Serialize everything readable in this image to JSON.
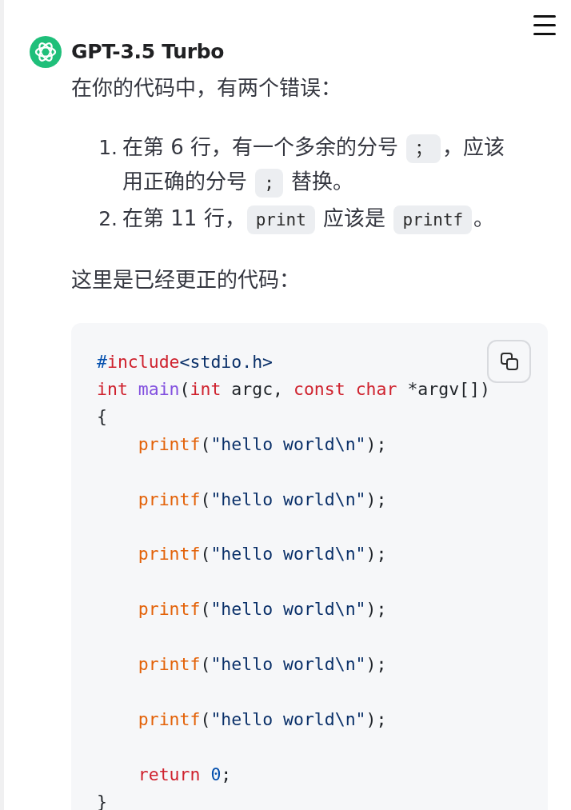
{
  "title": "GPT-3.5 Turbo",
  "message": {
    "intro": "在你的代码中，有两个错误：",
    "errors": [
      {
        "marker": "1.",
        "parts": [
          {
            "kind": "text",
            "text": "在第 6 行，有一个多余的分号 "
          },
          {
            "kind": "code",
            "text": "；"
          },
          {
            "kind": "text",
            "text": "，应该用正确的分号 "
          },
          {
            "kind": "code",
            "text": ";"
          },
          {
            "kind": "text",
            "text": " 替换。"
          }
        ]
      },
      {
        "marker": "2.",
        "parts": [
          {
            "kind": "text",
            "text": "在第 11 行，"
          },
          {
            "kind": "code",
            "text": "print"
          },
          {
            "kind": "text",
            "text": " 应该是 "
          },
          {
            "kind": "code",
            "text": "printf"
          },
          {
            "kind": "text",
            "text": "。"
          }
        ]
      }
    ],
    "outro": "这里是已经更正的代码：",
    "code_block": {
      "lines": [
        {
          "kind": "code",
          "tokens": [
            {
              "kind": "constant",
              "text": "#"
            },
            {
              "kind": "keyword",
              "text": "include"
            },
            {
              "kind": "string",
              "text": "<stdio.h>"
            }
          ]
        },
        {
          "kind": "code",
          "tokens": [
            {
              "kind": "keyword",
              "text": "int"
            },
            {
              "kind": "entity",
              "text": " main"
            },
            {
              "kind": "plain",
              "text": "("
            },
            {
              "kind": "keyword",
              "text": "int"
            },
            {
              "kind": "plain",
              "text": " argc, "
            },
            {
              "kind": "keyword",
              "text": "const"
            },
            {
              "kind": "keyword",
              "text": " char"
            },
            {
              "kind": "plain",
              "text": " *argv[])"
            }
          ]
        },
        {
          "kind": "code",
          "tokens": [
            {
              "kind": "plain",
              "text": "{"
            }
          ]
        },
        {
          "kind": "code",
          "tokens": [
            {
              "kind": "function",
              "text": "    printf"
            },
            {
              "kind": "plain",
              "text": "("
            },
            {
              "kind": "string",
              "text": "\"hello world\\n\""
            },
            {
              "kind": "plain",
              "text": ");"
            }
          ]
        },
        {
          "kind": "blank"
        },
        {
          "kind": "code",
          "tokens": [
            {
              "kind": "function",
              "text": "    printf"
            },
            {
              "kind": "plain",
              "text": "("
            },
            {
              "kind": "string",
              "text": "\"hello world\\n\""
            },
            {
              "kind": "plain",
              "text": ");"
            }
          ]
        },
        {
          "kind": "blank"
        },
        {
          "kind": "code",
          "tokens": [
            {
              "kind": "function",
              "text": "    printf"
            },
            {
              "kind": "plain",
              "text": "("
            },
            {
              "kind": "string",
              "text": "\"hello world\\n\""
            },
            {
              "kind": "plain",
              "text": ");"
            }
          ]
        },
        {
          "kind": "blank"
        },
        {
          "kind": "code",
          "tokens": [
            {
              "kind": "function",
              "text": "    printf"
            },
            {
              "kind": "plain",
              "text": "("
            },
            {
              "kind": "string",
              "text": "\"hello world\\n\""
            },
            {
              "kind": "plain",
              "text": ");"
            }
          ]
        },
        {
          "kind": "blank"
        },
        {
          "kind": "code",
          "tokens": [
            {
              "kind": "function",
              "text": "    printf"
            },
            {
              "kind": "plain",
              "text": "("
            },
            {
              "kind": "string",
              "text": "\"hello world\\n\""
            },
            {
              "kind": "plain",
              "text": ");"
            }
          ]
        },
        {
          "kind": "blank"
        },
        {
          "kind": "code",
          "tokens": [
            {
              "kind": "function",
              "text": "    printf"
            },
            {
              "kind": "plain",
              "text": "("
            },
            {
              "kind": "string",
              "text": "\"hello world\\n\""
            },
            {
              "kind": "plain",
              "text": ");"
            }
          ]
        },
        {
          "kind": "blank"
        },
        {
          "kind": "code",
          "tokens": [
            {
              "kind": "keyword",
              "text": "    return"
            },
            {
              "kind": "constant",
              "text": " 0"
            },
            {
              "kind": "plain",
              "text": ";"
            }
          ]
        },
        {
          "kind": "code",
          "tokens": [
            {
              "kind": "plain",
              "text": "}"
            }
          ]
        }
      ]
    }
  }
}
